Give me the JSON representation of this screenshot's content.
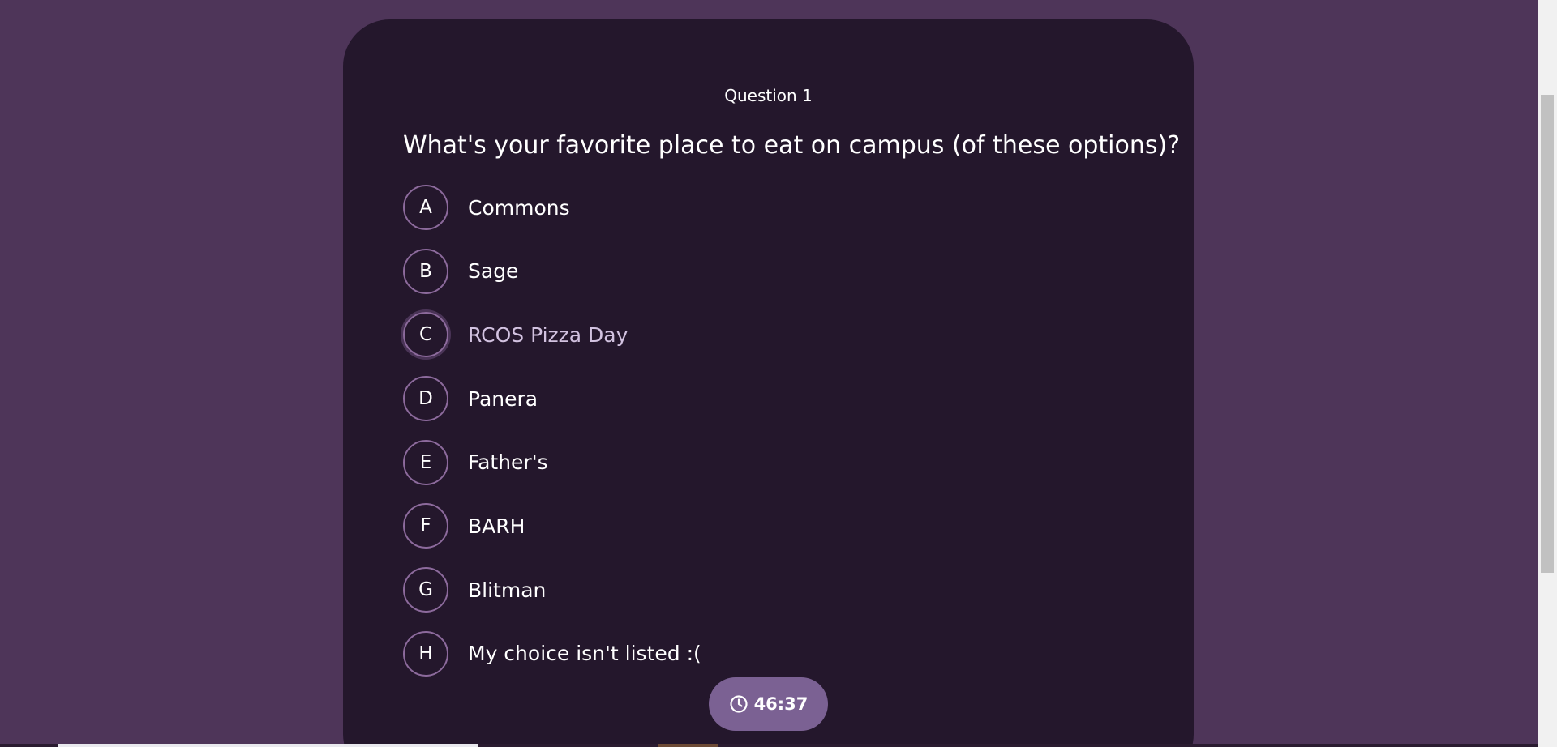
{
  "quiz": {
    "question_number": "Question 1",
    "question_text": "What's your favorite place to eat on campus (of these options)?",
    "options": [
      {
        "letter": "A",
        "label": "Commons"
      },
      {
        "letter": "B",
        "label": "Sage"
      },
      {
        "letter": "C",
        "label": "RCOS Pizza Day"
      },
      {
        "letter": "D",
        "label": "Panera"
      },
      {
        "letter": "E",
        "label": "Father's"
      },
      {
        "letter": "F",
        "label": "BARH"
      },
      {
        "letter": "G",
        "label": "Blitman"
      },
      {
        "letter": "H",
        "label": "My choice isn't listed :("
      }
    ],
    "hovered_option": "C"
  },
  "timer": {
    "value": "46:37",
    "icon": "clock-icon"
  },
  "colors": {
    "page_background": "#4e3559",
    "card_background": "#24172c",
    "option_border": "#8c6a9c",
    "timer_background": "#7b6193"
  }
}
